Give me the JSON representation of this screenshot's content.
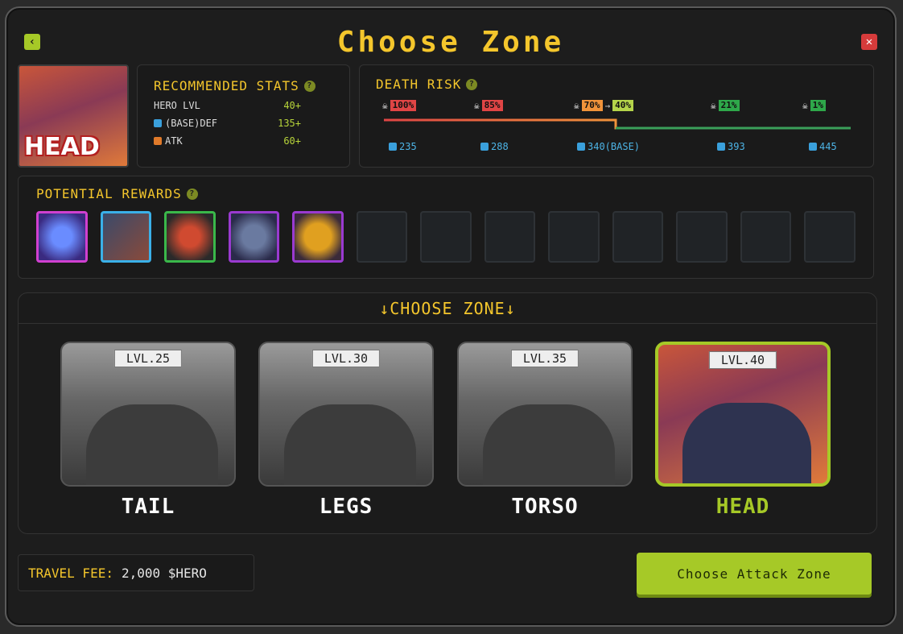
{
  "title": "Choose Zone",
  "portrait": {
    "label": "HEAD"
  },
  "stats": {
    "heading": "RECOMMENDED STATS",
    "rows": [
      {
        "label": "HERO LVL",
        "value": "40+"
      },
      {
        "label": "(BASE)DEF",
        "value": "135+"
      },
      {
        "label": "ATK",
        "value": "60+"
      }
    ]
  },
  "risk": {
    "heading": "DEATH RISK",
    "tags": [
      "100%",
      "85%",
      "70%",
      "40%",
      "21%",
      "1%"
    ],
    "defs": [
      "235",
      "288",
      "340(BASE)",
      "393",
      "445"
    ]
  },
  "rewards": {
    "heading": "POTENTIAL REWARDS"
  },
  "zones": {
    "heading": "↓CHOOSE ZONE↓",
    "items": [
      {
        "lvl": "LVL.25",
        "name": "TAIL"
      },
      {
        "lvl": "LVL.30",
        "name": "LEGS"
      },
      {
        "lvl": "LVL.35",
        "name": "TORSO"
      },
      {
        "lvl": "LVL.40",
        "name": "HEAD"
      }
    ]
  },
  "fee": {
    "label": "TRAVEL FEE:",
    "value": "2,000 $HERO"
  },
  "cta": "Choose Attack Zone",
  "colors": {
    "accent": "#a6c927",
    "title": "#f4c62c",
    "danger": "#d63b3b"
  }
}
